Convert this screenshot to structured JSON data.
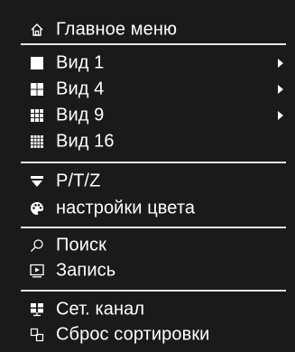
{
  "menu": {
    "header": {
      "label": "Главное меню",
      "icon": "home-icon"
    },
    "views": [
      {
        "label": "Вид 1",
        "icon": "view-1-icon",
        "submenu": true
      },
      {
        "label": "Вид 4",
        "icon": "view-4-icon",
        "submenu": true
      },
      {
        "label": "Вид 9",
        "icon": "view-9-icon",
        "submenu": true
      },
      {
        "label": "Вид 16",
        "icon": "view-16-icon",
        "submenu": false
      }
    ],
    "controls": [
      {
        "label": "P/T/Z",
        "icon": "ptz-icon"
      },
      {
        "label": "настройки цвета",
        "icon": "color-palette-icon"
      }
    ],
    "media": [
      {
        "label": "Поиск",
        "icon": "search-icon"
      },
      {
        "label": "Запись",
        "icon": "record-icon"
      }
    ],
    "network": [
      {
        "label": "Сет. канал",
        "icon": "network-channel-icon"
      },
      {
        "label": "Сброс сортировки",
        "icon": "reset-sort-icon"
      }
    ]
  },
  "colors": {
    "background": "#1a1a1a",
    "text": "#ffffff",
    "separator": "#e6e6e6"
  }
}
